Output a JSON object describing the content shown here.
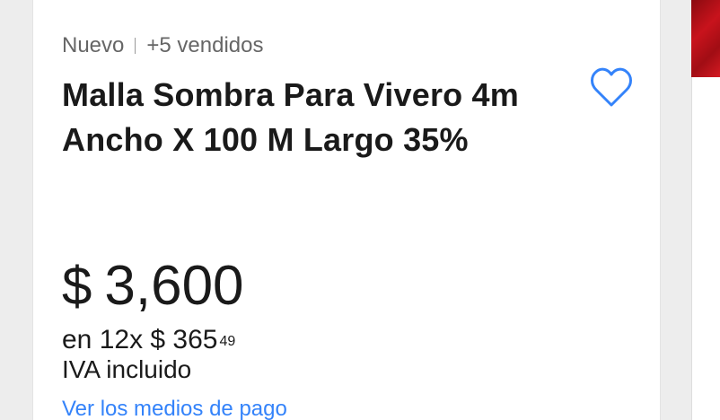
{
  "product": {
    "condition": "Nuevo",
    "sold": "+5 vendidos",
    "title": "Malla Sombra Para Vivero 4m Ancho X 100 M Largo 35%",
    "price": {
      "currency": "$",
      "amount": "3,600"
    },
    "installments": {
      "text": "en 12x $ 365",
      "cents": "49"
    },
    "tax_note": "IVA incluido",
    "more_link": "Ver los medios de pago"
  },
  "icons": {
    "favorite": "heart-icon"
  },
  "colors": {
    "accent": "#3483fa",
    "text": "#1a1a1a",
    "muted": "#666666",
    "thumb": "#c8131c"
  }
}
